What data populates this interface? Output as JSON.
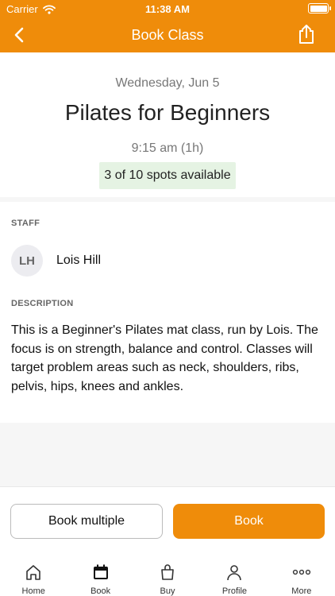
{
  "status_bar": {
    "carrier": "Carrier",
    "time": "11:38 AM"
  },
  "nav": {
    "title": "Book Class"
  },
  "class": {
    "date": "Wednesday, Jun 5",
    "title": "Pilates for Beginners",
    "time": "9:15 am (1h)",
    "spots": "3 of 10 spots available"
  },
  "staff": {
    "section_label": "STAFF",
    "initials": "LH",
    "name": "Lois Hill"
  },
  "description": {
    "section_label": "DESCRIPTION",
    "text": "This is a Beginner's Pilates mat class, run by Lois. The focus is on strength, balance and control. Classes will target problem areas such as neck, shoulders, ribs, pelvis, hips, knees and ankles."
  },
  "actions": {
    "book_multiple": "Book multiple",
    "book": "Book"
  },
  "tabs": [
    {
      "label": "Home",
      "icon": "home-icon"
    },
    {
      "label": "Book",
      "icon": "calendar-icon",
      "active": true
    },
    {
      "label": "Buy",
      "icon": "shopping-bag-icon"
    },
    {
      "label": "Profile",
      "icon": "person-icon"
    },
    {
      "label": "More",
      "icon": "more-dots-icon"
    }
  ],
  "colors": {
    "accent": "#ef8c0a",
    "spots_bg": "#e5f3e3"
  }
}
